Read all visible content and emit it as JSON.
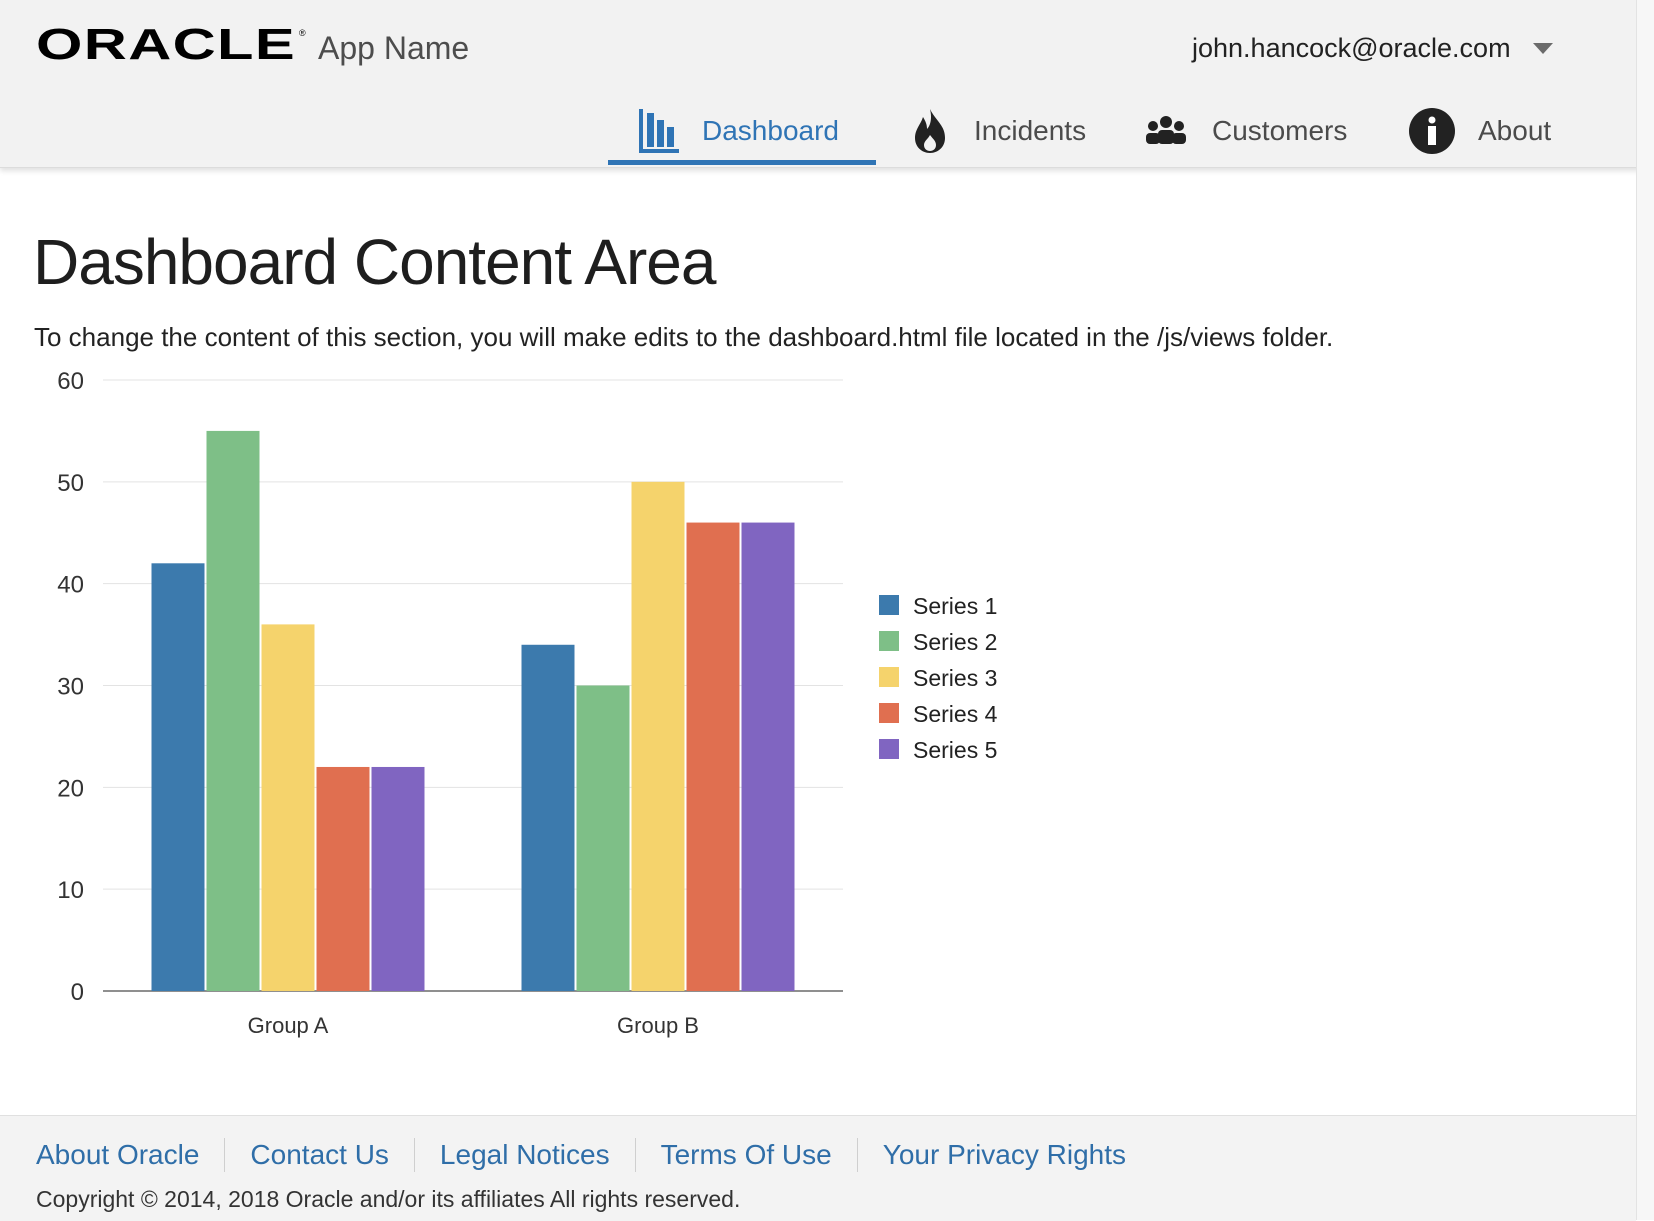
{
  "header": {
    "logo_text": "ORACLE",
    "app_name": "App Name",
    "user_email": "john.hancock@oracle.com",
    "nav": [
      {
        "label": "Dashboard",
        "icon": "bar-chart-icon",
        "selected": true
      },
      {
        "label": "Incidents",
        "icon": "fire-icon",
        "selected": false
      },
      {
        "label": "Customers",
        "icon": "people-icon",
        "selected": false
      },
      {
        "label": "About",
        "icon": "info-icon",
        "selected": false
      }
    ]
  },
  "content": {
    "title": "Dashboard Content Area",
    "description": "To change the content of this section, you will make edits to the dashboard.html file located in the /js/views folder."
  },
  "chart_data": {
    "type": "bar",
    "categories": [
      "Group A",
      "Group B"
    ],
    "series": [
      {
        "name": "Series 1",
        "values": [
          42,
          34
        ],
        "color": "#3c7aad"
      },
      {
        "name": "Series 2",
        "values": [
          55,
          30
        ],
        "color": "#7ebf87"
      },
      {
        "name": "Series 3",
        "values": [
          36,
          50
        ],
        "color": "#f5d36c"
      },
      {
        "name": "Series 4",
        "values": [
          22,
          46
        ],
        "color": "#e06f50"
      },
      {
        "name": "Series 5",
        "values": [
          22,
          46
        ],
        "color": "#8065c1"
      }
    ],
    "ylim": [
      0,
      60
    ],
    "yticks": [
      0,
      10,
      20,
      30,
      40,
      50,
      60
    ],
    "grid": true,
    "legend": "right"
  },
  "footer": {
    "links": [
      "About Oracle",
      "Contact Us",
      "Legal Notices",
      "Terms Of Use",
      "Your Privacy Rights"
    ],
    "copyright": "Copyright © 2014, 2018 Oracle and/or its affiliates All rights reserved."
  },
  "colors": {
    "accent": "#2f74b5",
    "header_bg": "#f2f2f2"
  }
}
